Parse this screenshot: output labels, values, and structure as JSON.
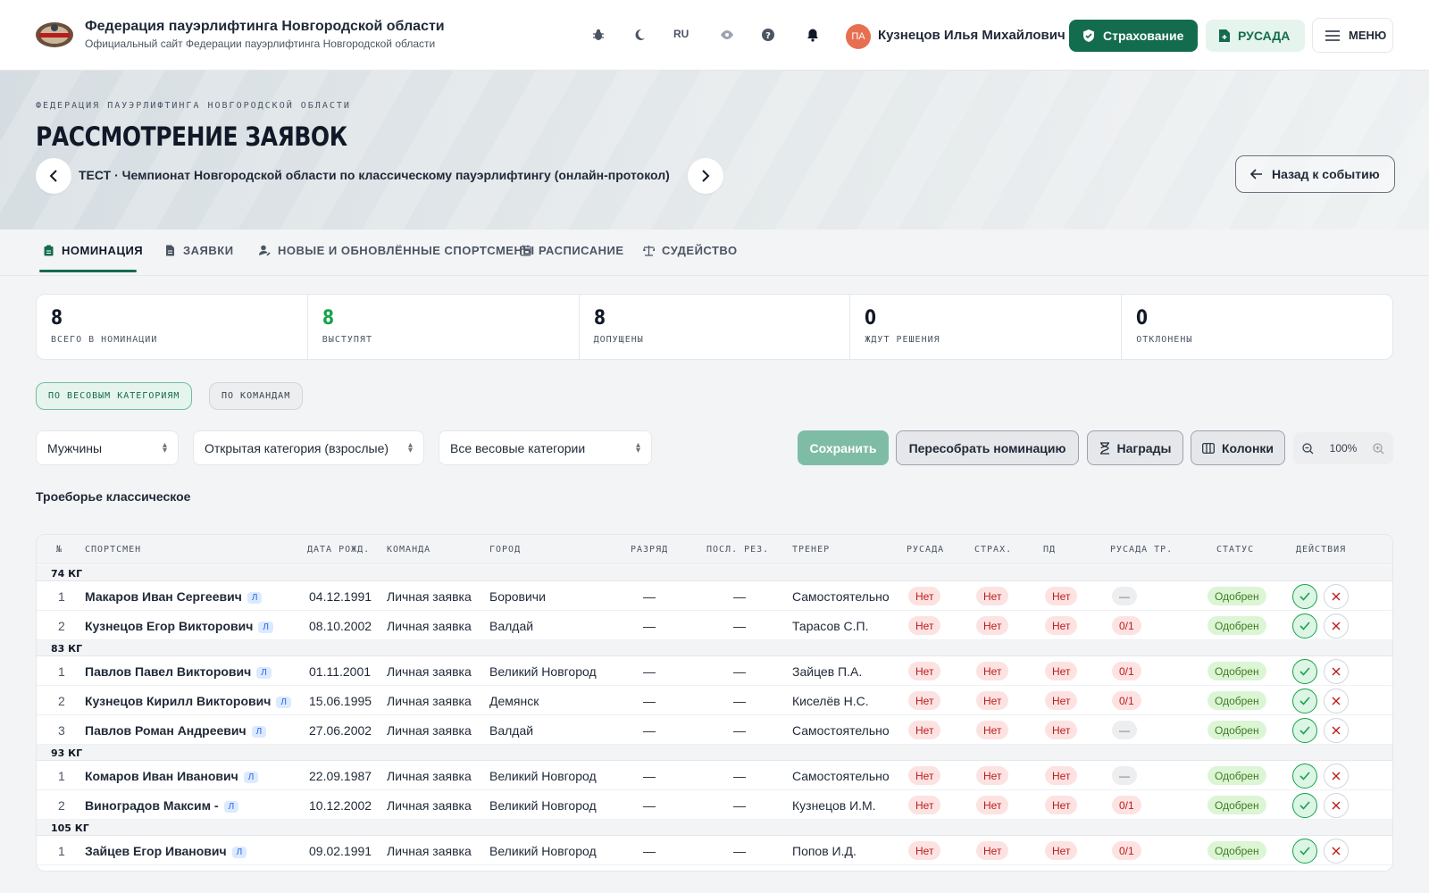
{
  "header": {
    "site_title": "Федерация пауэрлифтинга Новгородской области",
    "site_subtitle": "Официальный сайт Федерации пауэрлифтинга Новгородской области",
    "lang": "RU",
    "avatar_initials": "ПА",
    "user_name": "Кузнецов Илья Михайлович",
    "insurance_label": "Страхование",
    "rusada_label": "РУСАДА",
    "menu_label": "МЕНЮ"
  },
  "hero": {
    "eyebrow": "ФЕДЕРАЦИЯ ПАУЭРЛИФТИНГА НОВГОРОДСКОЙ ОБЛАСТИ",
    "title": "РАССМОТРЕНИЕ ЗАЯВОК",
    "event": "ТЕСТ · Чемпионат Новгородской области по классическому пауэрлифтингу (онлайн-протокол)",
    "back_label": "Назад к событию"
  },
  "tabs": [
    {
      "label": "НОМИНАЦИЯ",
      "icon": "clipboard-icon"
    },
    {
      "label": "ЗАЯВКИ",
      "icon": "file-icon"
    },
    {
      "label": "НОВЫЕ И ОБНОВЛЁННЫЕ СПОРТСМЕНЫ",
      "icon": "user-edit-icon"
    },
    {
      "label": "РАСПИСАНИЕ",
      "icon": "calendar-icon"
    },
    {
      "label": "СУДЕЙСТВО",
      "icon": "scales-icon"
    }
  ],
  "stats": [
    {
      "value": "8",
      "label": "Всего в номинации"
    },
    {
      "value": "8",
      "label": "Выступят"
    },
    {
      "value": "8",
      "label": "Допущены"
    },
    {
      "value": "0",
      "label": "Ждут решения"
    },
    {
      "value": "0",
      "label": "Отклонены"
    }
  ],
  "chips": {
    "by_weight": "ПО ВЕСОВЫМ КАТЕГОРИЯМ",
    "by_team": "ПО КОМАНДАМ"
  },
  "filters": {
    "gender": "Мужчины",
    "age": "Открытая категория (взрослые)",
    "weight": "Все весовые категории"
  },
  "toolbar": {
    "save": "Сохранить",
    "rebuild": "Пересобрать номинацию",
    "awards": "Награды",
    "columns": "Колонки",
    "zoom": "100%"
  },
  "section_title": "Троеборье классическое",
  "table": {
    "columns": [
      "№",
      "СПОРТСМЕН",
      "ДАТА РОЖД.",
      "КОМАНДА",
      "ГОРОД",
      "РАЗРЯД",
      "ПОСЛ. РЕЗ.",
      "ТРЕНЕР",
      "РУСАДА",
      "СТРАХ.",
      "ПД",
      "РУСАДА ТР.",
      "СТАТУС",
      "ДЕЙСТВИЯ"
    ],
    "badge": "Л",
    "dash": "—",
    "groups": [
      {
        "label": "74 КГ",
        "rows": [
          {
            "n": "1",
            "name": "Макаров Иван Сергеевич",
            "dob": "04.12.1991",
            "team": "Личная заявка",
            "city": "Боровичи",
            "rank": "—",
            "last": "—",
            "coach": "Самостоятельно",
            "rusada": "Нет",
            "ins": "Нет",
            "pd": "Нет",
            "rtr": "—",
            "status": "Одобрен"
          },
          {
            "n": "2",
            "name": "Кузнецов Егор Викторович",
            "dob": "08.10.2002",
            "team": "Личная заявка",
            "city": "Валдай",
            "rank": "—",
            "last": "—",
            "coach": "Тарасов С.П.",
            "rusada": "Нет",
            "ins": "Нет",
            "pd": "Нет",
            "rtr": "0/1",
            "status": "Одобрен"
          }
        ]
      },
      {
        "label": "83 КГ",
        "rows": [
          {
            "n": "1",
            "name": "Павлов Павел Викторович",
            "dob": "01.11.2001",
            "team": "Личная заявка",
            "city": "Великий Новгород",
            "rank": "—",
            "last": "—",
            "coach": "Зайцев П.А.",
            "rusada": "Нет",
            "ins": "Нет",
            "pd": "Нет",
            "rtr": "0/1",
            "status": "Одобрен"
          },
          {
            "n": "2",
            "name": "Кузнецов Кирилл Викторович",
            "dob": "15.06.1995",
            "team": "Личная заявка",
            "city": "Демянск",
            "rank": "—",
            "last": "—",
            "coach": "Киселёв Н.С.",
            "rusada": "Нет",
            "ins": "Нет",
            "pd": "Нет",
            "rtr": "0/1",
            "status": "Одобрен"
          },
          {
            "n": "3",
            "name": "Павлов Роман Андреевич",
            "dob": "27.06.2002",
            "team": "Личная заявка",
            "city": "Валдай",
            "rank": "—",
            "last": "—",
            "coach": "Самостоятельно",
            "rusada": "Нет",
            "ins": "Нет",
            "pd": "Нет",
            "rtr": "—",
            "status": "Одобрен"
          }
        ]
      },
      {
        "label": "93 КГ",
        "rows": [
          {
            "n": "1",
            "name": "Комаров Иван Иванович",
            "dob": "22.09.1987",
            "team": "Личная заявка",
            "city": "Великий Новгород",
            "rank": "—",
            "last": "—",
            "coach": "Самостоятельно",
            "rusada": "Нет",
            "ins": "Нет",
            "pd": "Нет",
            "rtr": "—",
            "status": "Одобрен"
          },
          {
            "n": "2",
            "name": "Виноградов Максим -",
            "dob": "10.12.2002",
            "team": "Личная заявка",
            "city": "Великий Новгород",
            "rank": "—",
            "last": "—",
            "coach": "Кузнецов И.М.",
            "rusada": "Нет",
            "ins": "Нет",
            "pd": "Нет",
            "rtr": "0/1",
            "status": "Одобрен"
          }
        ]
      },
      {
        "label": "105 КГ",
        "rows": [
          {
            "n": "1",
            "name": "Зайцев Егор Иванович",
            "dob": "09.02.1991",
            "team": "Личная заявка",
            "city": "Великий Новгород",
            "rank": "—",
            "last": "—",
            "coach": "Попов И.Д.",
            "rusada": "Нет",
            "ins": "Нет",
            "pd": "Нет",
            "rtr": "0/1",
            "status": "Одобрен"
          }
        ]
      }
    ]
  }
}
